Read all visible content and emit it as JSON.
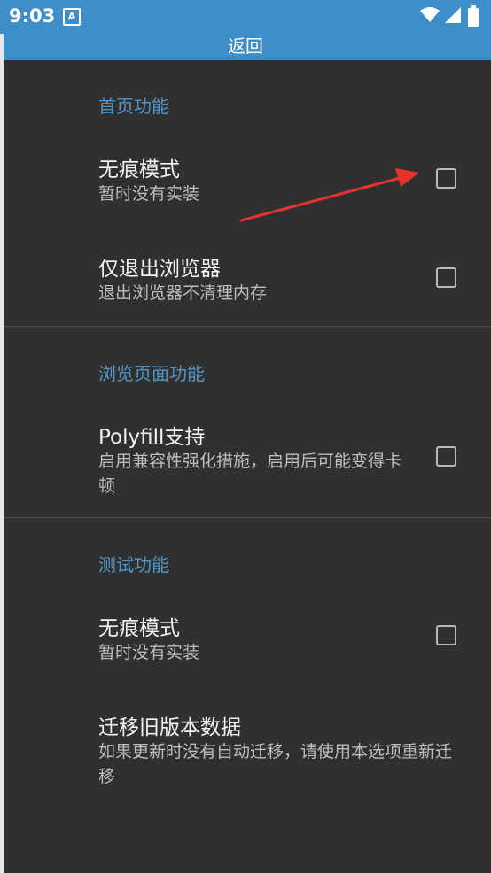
{
  "status_bar": {
    "time": "9:03",
    "app_badge": "A",
    "icons": [
      "wifi-icon",
      "signal-icon",
      "battery-icon"
    ]
  },
  "title_bar": {
    "back_label": "返回"
  },
  "sections": [
    {
      "header": "首页功能",
      "items": [
        {
          "title": "无痕模式",
          "subtitle": "暂时没有实装",
          "checked": false
        },
        {
          "title": "仅退出浏览器",
          "subtitle": "退出浏览器不清理内存",
          "checked": false
        }
      ]
    },
    {
      "header": "浏览页面功能",
      "items": [
        {
          "title": "Polyfill支持",
          "subtitle": "启用兼容性强化措施，启用后可能变得卡顿",
          "checked": false
        }
      ]
    },
    {
      "header": "测试功能",
      "items": [
        {
          "title": "无痕模式",
          "subtitle": "暂时没有实装",
          "checked": false
        },
        {
          "title": "迁移旧版本数据",
          "subtitle": "如果更新时没有自动迁移，请使用本选项重新迁移"
        }
      ]
    }
  ],
  "colors": {
    "primary": "#3f8ec9",
    "background": "#303030",
    "section_header": "#4f95c7",
    "annotation_arrow": "#e8322c"
  }
}
